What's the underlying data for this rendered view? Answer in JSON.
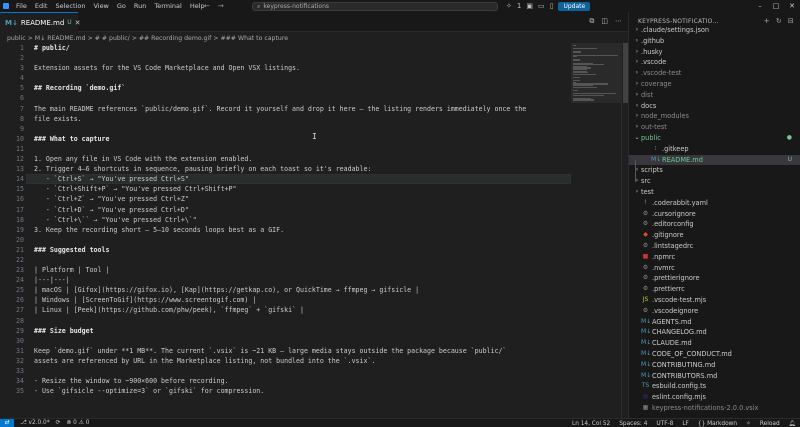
{
  "titlebar": {
    "menu": [
      "File",
      "Edit",
      "Selection",
      "View",
      "Go",
      "Run",
      "Terminal",
      "Help"
    ],
    "nav_back": "←",
    "nav_forward": "→",
    "search_text": "keypress-notifications",
    "notification_count": "1",
    "update_label": "Update"
  },
  "tab": {
    "icon_text": "M↓",
    "label": "README.md",
    "badge": "U"
  },
  "breadcrumb": "public > M↓ README.md > # # public/ > ## Recording demo.gif > ### What to capture",
  "editor": {
    "line_numbers": [
      "1",
      "2",
      "3",
      "4",
      "5",
      "6",
      "7",
      "8",
      "9",
      "10",
      "11",
      "12",
      "13",
      "14",
      "15",
      "16",
      "17",
      "18",
      "19",
      "20",
      "21",
      "22",
      "23",
      "24",
      "25",
      "26",
      "27",
      "28",
      "29",
      "30",
      "31",
      "32",
      "33",
      "34",
      "35"
    ],
    "lines": [
      "# public/",
      "",
      "Extension assets for the VS Code Marketplace and Open VSX listings.",
      "",
      "## Recording `demo.gif`",
      "",
      "The main README references `public/demo.gif`. Record it yourself and drop it here — the listing renders immediately once the",
      "file exists.",
      "",
      "### What to capture",
      "",
      "1. Open any file in VS Code with the extension enabled.",
      "2. Trigger 4–6 shortcuts in sequence, pausing briefly on each toast so it's readable:",
      "   - `Ctrl+S` → \"You've pressed Ctrl+S\"",
      "   - `Ctrl+Shift+P` → \"You've pressed Ctrl+Shift+P\"",
      "   - `Ctrl+Z` → \"You've pressed Ctrl+Z\"",
      "   - `Ctrl+D` → \"You've pressed Ctrl+D\"",
      "   - `Ctrl+\\`` → \"You've pressed Ctrl+\\`\"",
      "3. Keep the recording short — 5–10 seconds loops best as a GIF.",
      "",
      "### Suggested tools",
      "",
      "| Platform | Tool |",
      "|---|---|",
      "| macOS | [Gifox](https://gifox.io), [Kap](https://getkap.co), or QuickTime → ffmpeg → gifsicle |",
      "| Windows | [ScreenToGif](https://www.screentogif.com) |",
      "| Linux | [Peek](https://github.com/phw/peek), `ffmpeg` + `gifski` |",
      "",
      "### Size budget",
      "",
      "Keep `demo.gif` under **1 MB**. The current `.vsix` is ~21 KB — large media stays outside the package because `public/`",
      "assets are referenced by URL in the Marketplace listing, not bundled into the `.vsix`.",
      "",
      "- Resize the window to ~900×600 before recording.",
      "- Use `gifsicle --optimize=3` or `gifski` for compression."
    ]
  },
  "explorer": {
    "title": "KEYPRESS-NOTIFICATIO...",
    "items": [
      {
        "label": ".claude/settings.json",
        "kind": "folder",
        "indent": 0,
        "color": "#cccccc",
        "icon": "›",
        "badge": ""
      },
      {
        "label": ".github",
        "kind": "folder",
        "indent": 0,
        "color": "#cccccc",
        "icon": "›",
        "badge": ""
      },
      {
        "label": ".husky",
        "kind": "folder",
        "indent": 0,
        "color": "#cccccc",
        "icon": "›",
        "badge": ""
      },
      {
        "label": ".vscode",
        "kind": "folder",
        "indent": 0,
        "color": "#cccccc",
        "icon": "›",
        "badge": ""
      },
      {
        "label": ".vscode-test",
        "kind": "folder",
        "indent": 0,
        "color": "#8c8c8c",
        "icon": "›",
        "badge": ""
      },
      {
        "label": "coverage",
        "kind": "folder",
        "indent": 0,
        "color": "#8c8c8c",
        "icon": "›",
        "badge": ""
      },
      {
        "label": "dist",
        "kind": "folder",
        "indent": 0,
        "color": "#8c8c8c",
        "icon": "›",
        "badge": ""
      },
      {
        "label": "docs",
        "kind": "folder",
        "indent": 0,
        "color": "#cccccc",
        "icon": "›",
        "badge": ""
      },
      {
        "label": "node_modules",
        "kind": "folder",
        "indent": 0,
        "color": "#8c8c8c",
        "icon": "›",
        "badge": ""
      },
      {
        "label": "out-test",
        "kind": "folder",
        "indent": 0,
        "color": "#8c8c8c",
        "icon": "›",
        "badge": ""
      },
      {
        "label": "public",
        "kind": "folder-open",
        "indent": 0,
        "color": "#73c991",
        "icon": "⌄",
        "badge": "●"
      },
      {
        "label": ".gitkeep",
        "kind": "file",
        "indent": 1,
        "color": "#cccccc",
        "icon": "",
        "badge": ""
      },
      {
        "label": "README.md",
        "kind": "md",
        "indent": 1,
        "color": "#73c991",
        "icon": "",
        "badge": "U"
      },
      {
        "label": "scripts",
        "kind": "folder",
        "indent": 0,
        "color": "#cccccc",
        "icon": "›",
        "badge": ""
      },
      {
        "label": "src",
        "kind": "folder",
        "indent": 0,
        "color": "#cccccc",
        "icon": "›",
        "badge": ""
      },
      {
        "label": "test",
        "kind": "folder",
        "indent": 0,
        "color": "#cccccc",
        "icon": "›",
        "badge": ""
      },
      {
        "label": ".coderabbit.yaml",
        "kind": "yaml",
        "indent": 0,
        "color": "#cccccc",
        "icon": "",
        "badge": ""
      },
      {
        "label": ".cursorignore",
        "kind": "cfg",
        "indent": 0,
        "color": "#cccccc",
        "icon": "",
        "badge": ""
      },
      {
        "label": ".editorconfig",
        "kind": "cfg",
        "indent": 0,
        "color": "#cccccc",
        "icon": "",
        "badge": ""
      },
      {
        "label": ".gitignore",
        "kind": "git",
        "indent": 0,
        "color": "#cccccc",
        "icon": "",
        "badge": ""
      },
      {
        "label": ".lintstagedrc",
        "kind": "cfg",
        "indent": 0,
        "color": "#cccccc",
        "icon": "",
        "badge": ""
      },
      {
        "label": ".npmrc",
        "kind": "npm",
        "indent": 0,
        "color": "#cccccc",
        "icon": "",
        "badge": ""
      },
      {
        "label": ".nvmrc",
        "kind": "cfg",
        "indent": 0,
        "color": "#cccccc",
        "icon": "",
        "badge": ""
      },
      {
        "label": ".prettierignore",
        "kind": "cfg",
        "indent": 0,
        "color": "#cccccc",
        "icon": "",
        "badge": ""
      },
      {
        "label": ".prettierrc",
        "kind": "cfg",
        "indent": 0,
        "color": "#cccccc",
        "icon": "",
        "badge": ""
      },
      {
        "label": ".vscode-test.mjs",
        "kind": "js",
        "indent": 0,
        "color": "#cccccc",
        "icon": "",
        "badge": ""
      },
      {
        "label": ".vscodeignore",
        "kind": "cfg",
        "indent": 0,
        "color": "#cccccc",
        "icon": "",
        "badge": ""
      },
      {
        "label": "AGENTS.md",
        "kind": "md",
        "indent": 0,
        "color": "#cccccc",
        "icon": "",
        "badge": ""
      },
      {
        "label": "CHANGELOG.md",
        "kind": "md",
        "indent": 0,
        "color": "#cccccc",
        "icon": "",
        "badge": ""
      },
      {
        "label": "CLAUDE.md",
        "kind": "md",
        "indent": 0,
        "color": "#cccccc",
        "icon": "",
        "badge": ""
      },
      {
        "label": "CODE_OF_CONDUCT.md",
        "kind": "md",
        "indent": 0,
        "color": "#cccccc",
        "icon": "",
        "badge": ""
      },
      {
        "label": "CONTRIBUTING.md",
        "kind": "md",
        "indent": 0,
        "color": "#cccccc",
        "icon": "",
        "badge": ""
      },
      {
        "label": "CONTRIBUTORS.md",
        "kind": "md",
        "indent": 0,
        "color": "#cccccc",
        "icon": "",
        "badge": ""
      },
      {
        "label": "esbuild.config.ts",
        "kind": "ts",
        "indent": 0,
        "color": "#cccccc",
        "icon": "",
        "badge": ""
      },
      {
        "label": "eslint.config.mjs",
        "kind": "eslint",
        "indent": 0,
        "color": "#cccccc",
        "icon": "",
        "badge": ""
      },
      {
        "label": "keypress-notifications-2.0.0.vsix",
        "kind": "vsix",
        "indent": 0,
        "color": "#8c8c8c",
        "icon": "",
        "badge": ""
      }
    ]
  },
  "statusbar": {
    "branch": "v2.0.0*",
    "errors": "⊗ 0 ⚠ 0",
    "position": "Ln 14, Col 52",
    "indent": "Spaces: 4",
    "encoding": "UTF-8",
    "eol": "LF",
    "language": "{} Markdown",
    "reload": "Reload"
  },
  "colors": {
    "accent": "#0078d4",
    "untracked": "#73c991",
    "md_icon": "#519aba"
  }
}
